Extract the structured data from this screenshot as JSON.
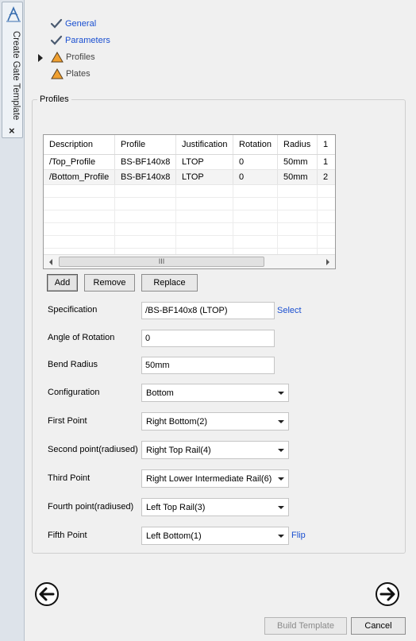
{
  "sidebar": {
    "tab_label": "Create Gate Template",
    "close_label": "×"
  },
  "steps": [
    {
      "label": "General",
      "status": "done"
    },
    {
      "label": "Parameters",
      "status": "done"
    },
    {
      "label": "Profiles",
      "status": "warning",
      "current": true
    },
    {
      "label": "Plates",
      "status": "warning"
    }
  ],
  "group": {
    "title": "Profiles"
  },
  "table": {
    "columns": [
      "Description",
      "Profile",
      "Justification",
      "Rotation",
      "Radius",
      "1"
    ],
    "rows": [
      [
        "/Top_Profile",
        "BS-BF140x8",
        "LTOP",
        "0",
        "50mm",
        "1"
      ],
      [
        "/Bottom_Profile",
        "BS-BF140x8",
        "LTOP",
        "0",
        "50mm",
        "2"
      ]
    ],
    "scroll_thumb_grip": "III"
  },
  "buttons": {
    "add": "Add",
    "remove": "Remove",
    "replace": "Replace",
    "build": "Build Template",
    "cancel": "Cancel"
  },
  "form": {
    "specification": {
      "label": "Specification",
      "value": "/BS-BF140x8 (LTOP)",
      "link": "Select"
    },
    "rotation": {
      "label": "Angle of Rotation",
      "value": "0"
    },
    "bend_radius": {
      "label": "Bend Radius",
      "value": "50mm"
    },
    "configuration": {
      "label": "Configuration",
      "value": "Bottom"
    },
    "first_point": {
      "label": "First Point",
      "value": "Right Bottom(2)"
    },
    "second_point": {
      "label": "Second point(radiused)",
      "value": "Right Top Rail(4)"
    },
    "third_point": {
      "label": "Third Point",
      "value": "Right Lower Intermediate Rail(6)"
    },
    "fourth_point": {
      "label": "Fourth point(radiused)",
      "value": "Left Top Rail(3)"
    },
    "fifth_point": {
      "label": "Fifth Point",
      "value": "Left Bottom(1)",
      "link": "Flip"
    }
  },
  "colors": {
    "link": "#1a4fd0",
    "warning": "#f0a030",
    "check": "#4a5a70"
  }
}
